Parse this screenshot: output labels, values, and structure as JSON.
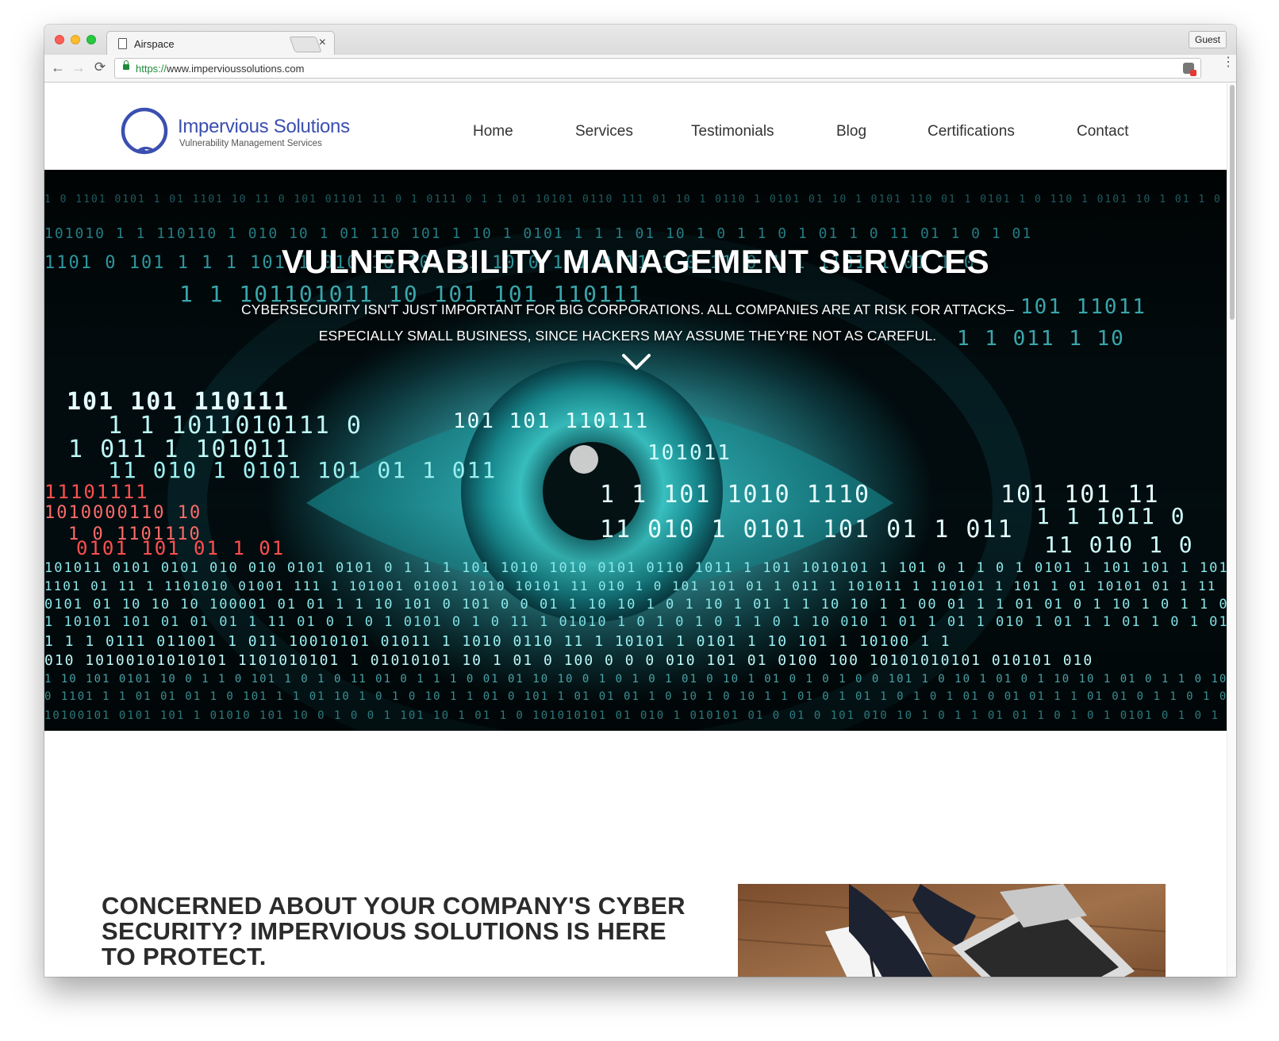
{
  "browser": {
    "tab_title": "Airspace",
    "tab_close": "×",
    "profile_button": "Guest",
    "url_scheme": "https://",
    "url_rest": "www.impervioussolutions.com",
    "back_glyph": "←",
    "forward_glyph": "→",
    "reload_glyph": "⟳",
    "menu_glyph": "⋮"
  },
  "header": {
    "brand_name": "Impervious Solutions",
    "brand_tagline": "Vulnerability Management Services",
    "nav": [
      "Home",
      "Services",
      "Testimonials",
      "Blog",
      "Certifications",
      "Contact"
    ]
  },
  "hero": {
    "title": "VULNERABILITY MANAGEMENT SERVICES",
    "subtitle": "CYBERSECURITY ISN'T JUST IMPORTANT FOR BIG CORPORATIONS. ALL COMPANIES ARE AT RISK FOR ATTACKS–ESPECIALLY SMALL BUSINESS, SINCE HACKERS MAY ASSUME THEY'RE NOT AS CAREFUL."
  },
  "content": {
    "headline": "CONCERNED ABOUT YOUR COMPANY'S CYBER SECURITY? IMPERVIOUS SOLUTIONS IS HERE TO PROTECT."
  },
  "colors": {
    "brand_blue": "#3a4fb0",
    "secure_green": "#1f8a3a",
    "hero_cyan": "#2fc4c6"
  },
  "icons": [
    "page-icon",
    "lock-icon",
    "extension-icon",
    "chevron-down-icon",
    "logo-icon"
  ]
}
